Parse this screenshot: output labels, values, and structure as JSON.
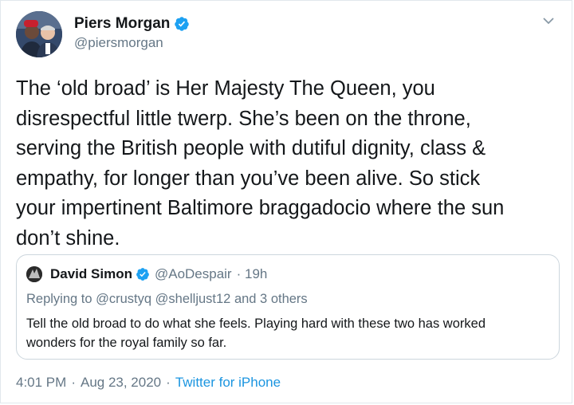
{
  "tweet": {
    "author": {
      "display_name": "Piers Morgan",
      "handle": "@piersmorgan",
      "verified_color": "#1da1f2"
    },
    "text": "The ‘old broad’ is Her Majesty The Queen, you\ndisrespectful little twerp. She’s been on the throne,\nserving the British people with dutiful dignity, class &\nempathy, for longer than you’ve been alive. So stick\nyour impertinent Baltimore braggadocio where the sun\ndon’t shine.",
    "timestamp": "4:01 PM",
    "date": "Aug 23, 2020",
    "separator": "·",
    "source": "Twitter for iPhone"
  },
  "quoted": {
    "display_name": "David Simon",
    "handle": "@AoDespair",
    "time": "· 19h",
    "replying_to": "Replying to @crustyq @shelljust12 and 3 others",
    "text": "Tell the old broad to do what she feels. Playing hard with these two has worked\nwonders for the royal family so far."
  },
  "colors": {
    "link": "#1b95e0",
    "secondary_text": "#657786",
    "border": "#ccd6dd"
  },
  "icons": [
    "verified-badge-icon",
    "chevron-down-icon"
  ]
}
